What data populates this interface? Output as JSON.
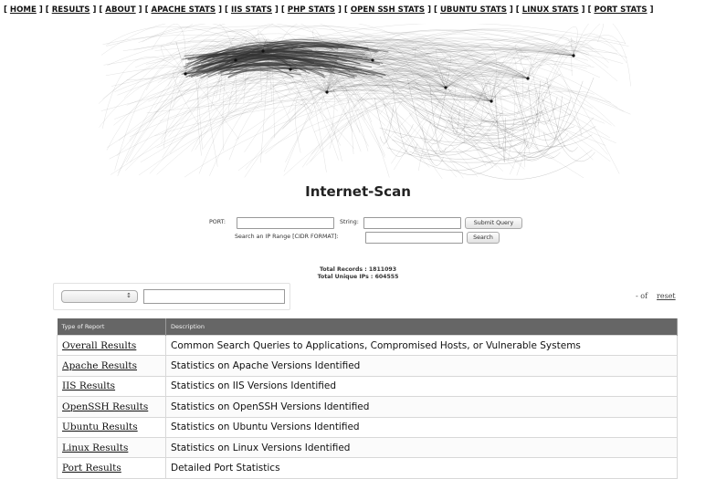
{
  "nav": {
    "items": [
      "HOME",
      "RESULTS",
      "ABOUT",
      "APACHE STATS",
      "IIS STATS",
      "PHP STATS",
      "OPEN SSH STATS",
      "UBUNTU STATS",
      "LINUX STATS",
      "PORT STATS"
    ]
  },
  "page_title": "Internet-Scan",
  "search": {
    "port_label": "PORT:",
    "string_label": "String:",
    "submit_label": "Submit Query",
    "ip_range_label": "Search an IP Range [CIDR FORMAT]:",
    "search_label": "Search"
  },
  "totals": {
    "records": "Total Records : 1811093",
    "unique_ips": "Total Unique IPs : 604555"
  },
  "filter": {
    "select_arrow": "↕"
  },
  "pager": {
    "of_text": "- of",
    "reset_label": "reset"
  },
  "table": {
    "headers": [
      "Type of Report",
      "Description"
    ],
    "rows": [
      {
        "name": "Overall Results",
        "description": "Common Search Queries to Applications, Compromised Hosts, or Vulnerable Systems"
      },
      {
        "name": "Apache Results",
        "description": "Statistics on Apache Versions Identified"
      },
      {
        "name": "IIS Results",
        "description": "Statistics on IIS Versions Identified"
      },
      {
        "name": "OpenSSH Results",
        "description": "Statistics on OpenSSH Versions Identified"
      },
      {
        "name": "Ubuntu Results",
        "description": "Statistics on Ubuntu Versions Identified"
      },
      {
        "name": "Linux Results",
        "description": "Statistics on Linux Versions Identified"
      },
      {
        "name": "Port Results",
        "description": "Detailed Port Statistics"
      }
    ]
  },
  "colors": {
    "table_header_bg": "#666666",
    "page_bg": "#ffffff"
  }
}
